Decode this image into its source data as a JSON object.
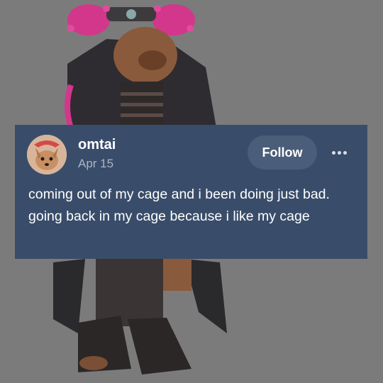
{
  "post": {
    "username": "omtai",
    "date": "Apr 15",
    "follow_label": "Follow",
    "body": "coming out of my cage and i been doing just bad. going back in my cage because i like my cage"
  },
  "icons": {
    "avatar": "dog-avatar",
    "more": "more-options-icon"
  },
  "colors": {
    "background": "#7b7b7b",
    "card": "#394d6a",
    "follow_button": "#4a5d79"
  }
}
